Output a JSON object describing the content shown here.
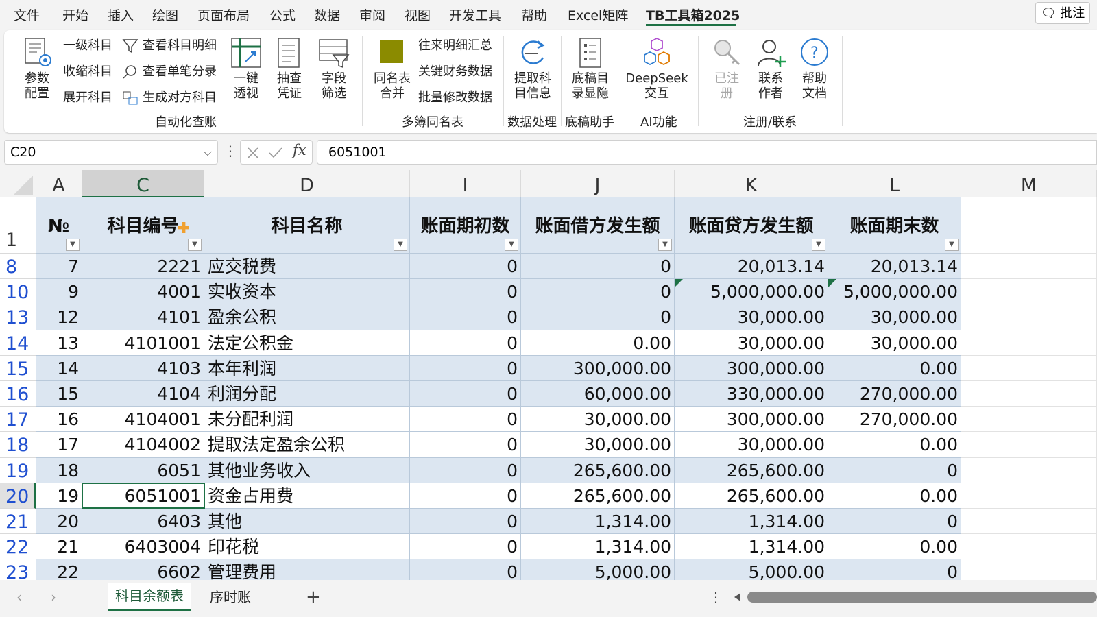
{
  "menu": {
    "items": [
      "文件",
      "开始",
      "插入",
      "绘图",
      "页面布局",
      "公式",
      "数据",
      "审阅",
      "视图",
      "开发工具",
      "帮助",
      "Excel矩阵",
      "TB工具箱2025"
    ],
    "active_index": 12,
    "comment_button": "批注"
  },
  "ribbon": {
    "params_config": "参数配置",
    "auto": {
      "level1": "一级科目",
      "collapse": "收缩科目",
      "expand": "展开科目",
      "view_detail": "查看科目明细",
      "view_single": "查看单笔分录",
      "generate_counter": "生成对方科目",
      "one_click_pivot": "一键透视",
      "sample_voucher": "抽查凭证",
      "field_filter": "字段筛选",
      "group_label": "自动化查账"
    },
    "multi": {
      "merge_same_name": "同名表合并",
      "ar_detail_summary": "往来明细汇总",
      "key_fin_data": "关键财务数据",
      "batch_modify": "批量修改数据",
      "group_label": "多簿同名表"
    },
    "data_proc": {
      "extract_info": "提取科目信息",
      "group_label": "数据处理"
    },
    "draft": {
      "show_hide": "底稿目录显隐",
      "group_label": "底稿助手"
    },
    "ai": {
      "deepseek": "DeepSeek交互",
      "group_label": "AI功能"
    },
    "reg": {
      "registered": "已注册",
      "contact": "联系作者",
      "help": "帮助文档",
      "group_label": "注册/联系"
    },
    "accent_color": "#8b8b00"
  },
  "formula_bar": {
    "name_box": "C20",
    "formula": "6051001"
  },
  "sheet": {
    "col_letters": [
      "A",
      "C",
      "D",
      "I",
      "J",
      "K",
      "L",
      "M"
    ],
    "selected_col": "C",
    "header_row_num": "1",
    "headers": [
      "№",
      "科目编号",
      "科目名称",
      "账面期初数",
      "账面借方发生额",
      "账面贷方发生额",
      "账面期末数"
    ],
    "rows": [
      {
        "rn": "8",
        "no": "7",
        "code": "2221",
        "name": "应交税费",
        "open": "0",
        "debit": "0",
        "credit": "20,013.14",
        "close": "20,013.14",
        "band": true
      },
      {
        "rn": "10",
        "no": "9",
        "code": "4001",
        "name": "实收资本",
        "open": "0",
        "debit": "0",
        "credit": "5,000,000.00",
        "close": "5,000,000.00",
        "band": true
      },
      {
        "rn": "13",
        "no": "12",
        "code": "4101",
        "name": "盈余公积",
        "open": "0",
        "debit": "0",
        "credit": "30,000.00",
        "close": "30,000.00",
        "band": true
      },
      {
        "rn": "14",
        "no": "13",
        "code": "4101001",
        "name": "法定公积金",
        "open": "0",
        "debit": "0.00",
        "credit": "30,000.00",
        "close": "30,000.00",
        "band": false
      },
      {
        "rn": "15",
        "no": "14",
        "code": "4103",
        "name": "本年利润",
        "open": "0",
        "debit": "300,000.00",
        "credit": "300,000.00",
        "close": "0.00",
        "band": true
      },
      {
        "rn": "16",
        "no": "15",
        "code": "4104",
        "name": "利润分配",
        "open": "0",
        "debit": "60,000.00",
        "credit": "330,000.00",
        "close": "270,000.00",
        "band": true
      },
      {
        "rn": "17",
        "no": "16",
        "code": "4104001",
        "name": "未分配利润",
        "open": "0",
        "debit": "30,000.00",
        "credit": "300,000.00",
        "close": "270,000.00",
        "band": false
      },
      {
        "rn": "18",
        "no": "17",
        "code": "4104002",
        "name": "提取法定盈余公积",
        "open": "0",
        "debit": "30,000.00",
        "credit": "30,000.00",
        "close": "0.00",
        "band": false
      },
      {
        "rn": "19",
        "no": "18",
        "code": "6051",
        "name": "其他业务收入",
        "open": "0",
        "debit": "265,600.00",
        "credit": "265,600.00",
        "close": "0",
        "band": true
      },
      {
        "rn": "20",
        "no": "19",
        "code": "6051001",
        "name": "资金占用费",
        "open": "0",
        "debit": "265,600.00",
        "credit": "265,600.00",
        "close": "0.00",
        "band": false
      },
      {
        "rn": "21",
        "no": "20",
        "code": "6403",
        "name": "其他",
        "open": "0",
        "debit": "1,314.00",
        "credit": "1,314.00",
        "close": "0",
        "band": true
      },
      {
        "rn": "22",
        "no": "21",
        "code": "6403004",
        "name": "印花税",
        "open": "0",
        "debit": "1,314.00",
        "credit": "1,314.00",
        "close": "0.00",
        "band": false
      },
      {
        "rn": "23",
        "no": "22",
        "code": "6602",
        "name": "管理费用",
        "open": "0",
        "debit": "5,000.00",
        "credit": "5,000.00",
        "close": "0",
        "band": true
      }
    ]
  },
  "tabs": {
    "items": [
      "科目余额表",
      "序时账"
    ],
    "active_index": 0,
    "add_label": "+"
  }
}
